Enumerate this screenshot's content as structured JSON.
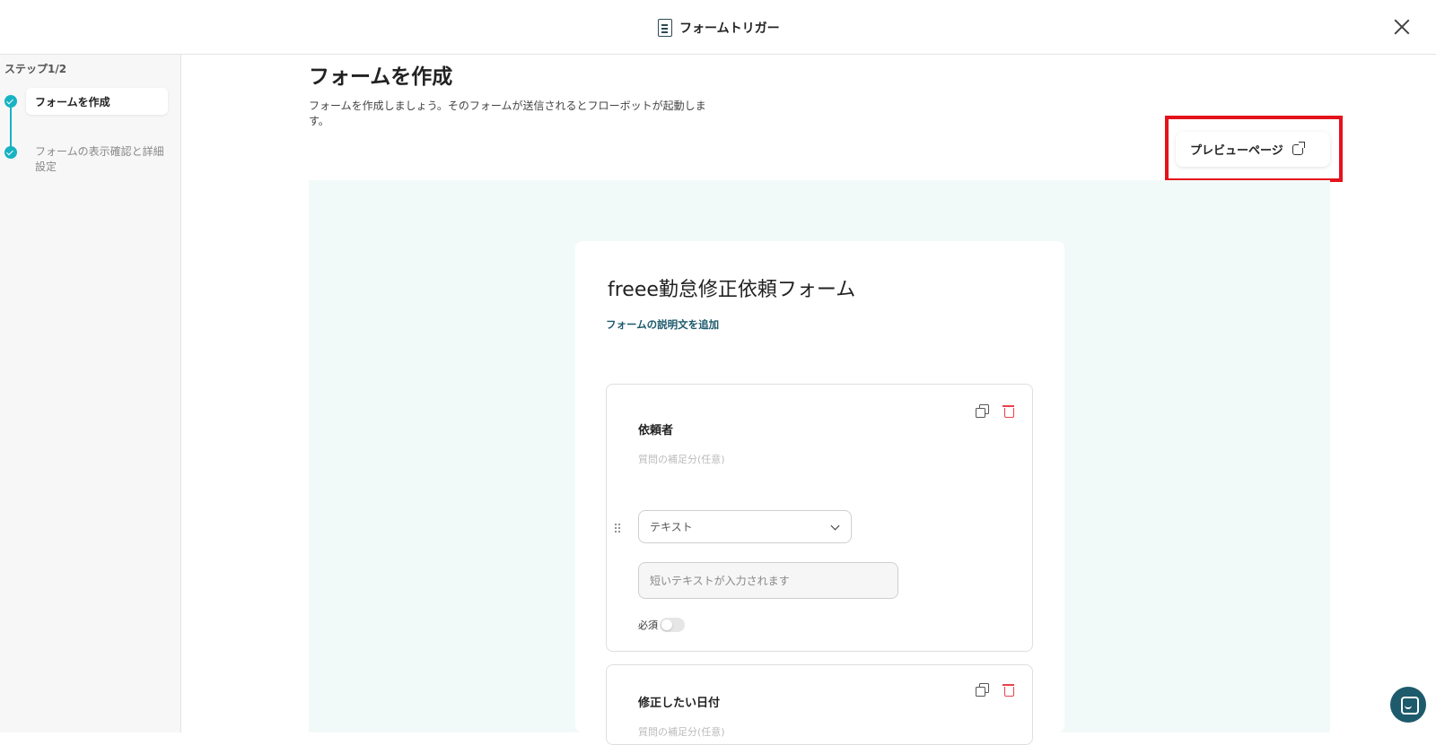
{
  "header": {
    "title": "フォームトリガー",
    "icon": "form-document-icon",
    "close_icon": "close-icon"
  },
  "sidebar": {
    "step_counter": "ステップ1/2",
    "steps": [
      {
        "label": "フォームを作成",
        "status": "active"
      },
      {
        "label": "フォームの表示確認と詳細設定",
        "status": "pending"
      }
    ],
    "accent_color": "#17b3c3"
  },
  "main": {
    "title": "フォームを作成",
    "description": "フォームを作成しましょう。そのフォームが送信されるとフローボットが起動します。",
    "preview_button": {
      "label": "プレビューページ",
      "icon": "external-link-icon",
      "highlight_color": "#e4121b"
    },
    "form": {
      "title": "freee勤怠修正依頼フォーム",
      "add_description_link": "フォームの説明文を追加",
      "questions": [
        {
          "title": "依頼者",
          "subtitle": "質問の補足分(任意)",
          "type": "テキスト",
          "answer_placeholder": "短いテキストが入力されます",
          "required_label": "必須",
          "required": false
        },
        {
          "title": "修正したい日付",
          "subtitle": "質問の補足分(任意)"
        }
      ]
    }
  },
  "chat": {
    "icon": "chat-icon",
    "color": "#1d5a6b"
  }
}
